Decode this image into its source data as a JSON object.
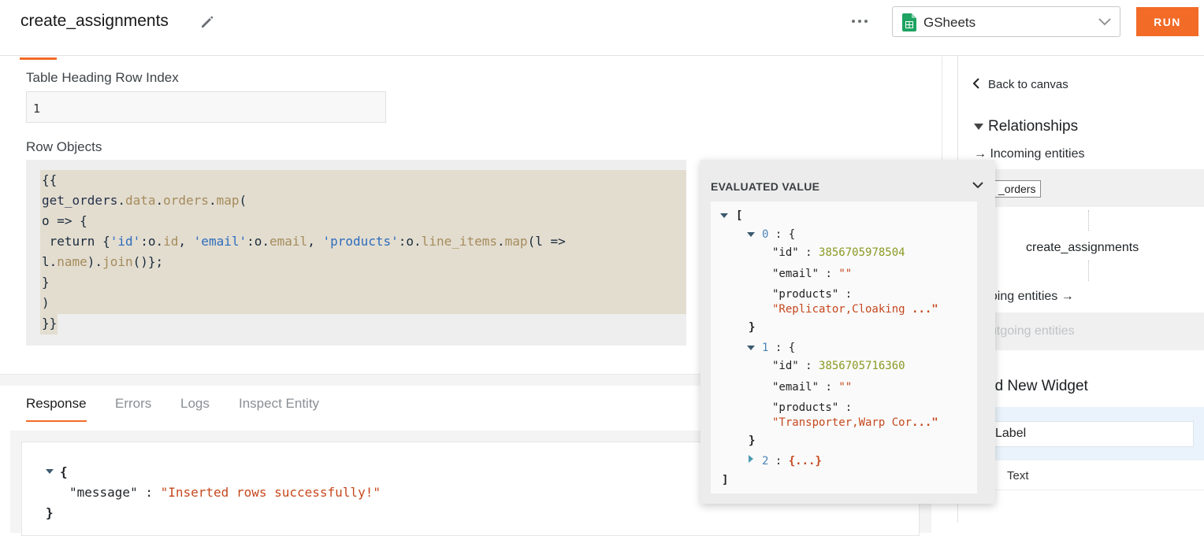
{
  "header": {
    "title": "create_assignments",
    "datasource": "GSheets",
    "run_label": "RUN"
  },
  "form": {
    "heading_row_label": "Table Heading Row Index",
    "heading_row_value": "1",
    "row_objects_label": "Row Objects",
    "code": {
      "l1": "{{",
      "l2_a": "get_orders",
      "l2_b": ".",
      "l2_c": "data",
      "l2_d": ".",
      "l2_e": "orders",
      "l2_f": ".",
      "l2_g": "map",
      "l2_h": "(",
      "l3": "o => {",
      "l4_a": " return {",
      "l4_b": "'id'",
      "l4_c": ":o.",
      "l4_d": "id",
      "l4_e": ", ",
      "l4_f": "'email'",
      "l4_g": ":o.",
      "l4_h": "email",
      "l4_i": ", ",
      "l4_j": "'products'",
      "l4_k": ":o.",
      "l4_l": "line_items",
      "l4_m": ".",
      "l4_n": "map",
      "l4_o": "(l =>",
      "l5_a": "l.",
      "l5_b": "name",
      "l5_c": ").",
      "l5_d": "join",
      "l5_e": "()};",
      "l6": "}",
      "l7": ")",
      "l8": "}}"
    }
  },
  "response": {
    "tabs": [
      "Response",
      "Errors",
      "Logs",
      "Inspect Entity"
    ],
    "open_brace": "{",
    "message_key": "\"message\"",
    "colon": " : ",
    "message_value": "\"Inserted rows successfully!\"",
    "close_brace": "}"
  },
  "evaluated": {
    "title": "EVALUATED VALUE",
    "open_bracket": "[",
    "close_bracket": "]",
    "items": [
      {
        "index": "0",
        "id_key": "\"id\"",
        "id_value": "3856705978504",
        "email_key": "\"email\"",
        "email_value": "\"\"",
        "products_key": "\"products\"",
        "products_value": "\"Replicator,Cloaking",
        "products_ellipsis": "...\""
      },
      {
        "index": "1",
        "id_key": "\"id\"",
        "id_value": "3856705716360",
        "email_key": "\"email\"",
        "email_value": "\"\"",
        "products_key": "\"products\"",
        "products_value": "\"Transporter,Warp Cor",
        "products_ellipsis": "...\""
      }
    ],
    "collapsed_index": "2",
    "collapsed_text": "{...}",
    "obj_open": " : {",
    "obj_close": "}",
    "sep": " : "
  },
  "right_panel": {
    "back_label": "Back to canvas",
    "relationships": "Relationships",
    "incoming": "→ Incoming entities",
    "incoming_entity": "_orders",
    "current_entity": "create_assignments",
    "outgoing": "going entities →",
    "no_outgoing": "utgoing entities",
    "add_widget": "dd New Widget",
    "widget_search": "Label",
    "widget_option": "Text"
  }
}
